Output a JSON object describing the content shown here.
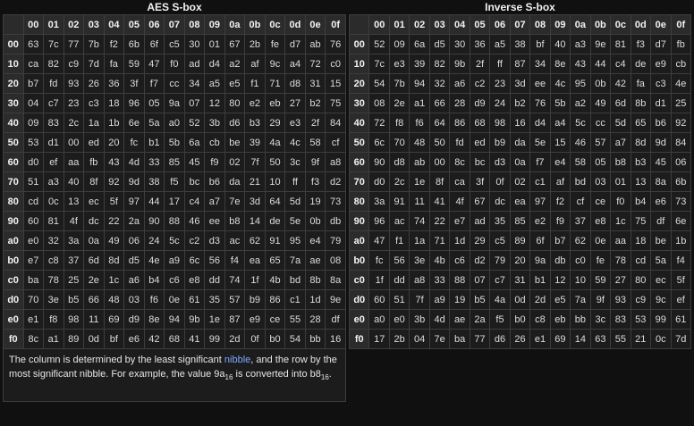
{
  "aes": {
    "caption": "AES S-box",
    "col_headers": [
      "00",
      "01",
      "02",
      "03",
      "04",
      "05",
      "06",
      "07",
      "08",
      "09",
      "0a",
      "0b",
      "0c",
      "0d",
      "0e",
      "0f"
    ],
    "rows": [
      {
        "h": "00",
        "c": [
          "63",
          "7c",
          "77",
          "7b",
          "f2",
          "6b",
          "6f",
          "c5",
          "30",
          "01",
          "67",
          "2b",
          "fe",
          "d7",
          "ab",
          "76"
        ]
      },
      {
        "h": "10",
        "c": [
          "ca",
          "82",
          "c9",
          "7d",
          "fa",
          "59",
          "47",
          "f0",
          "ad",
          "d4",
          "a2",
          "af",
          "9c",
          "a4",
          "72",
          "c0"
        ]
      },
      {
        "h": "20",
        "c": [
          "b7",
          "fd",
          "93",
          "26",
          "36",
          "3f",
          "f7",
          "cc",
          "34",
          "a5",
          "e5",
          "f1",
          "71",
          "d8",
          "31",
          "15"
        ]
      },
      {
        "h": "30",
        "c": [
          "04",
          "c7",
          "23",
          "c3",
          "18",
          "96",
          "05",
          "9a",
          "07",
          "12",
          "80",
          "e2",
          "eb",
          "27",
          "b2",
          "75"
        ]
      },
      {
        "h": "40",
        "c": [
          "09",
          "83",
          "2c",
          "1a",
          "1b",
          "6e",
          "5a",
          "a0",
          "52",
          "3b",
          "d6",
          "b3",
          "29",
          "e3",
          "2f",
          "84"
        ]
      },
      {
        "h": "50",
        "c": [
          "53",
          "d1",
          "00",
          "ed",
          "20",
          "fc",
          "b1",
          "5b",
          "6a",
          "cb",
          "be",
          "39",
          "4a",
          "4c",
          "58",
          "cf"
        ]
      },
      {
        "h": "60",
        "c": [
          "d0",
          "ef",
          "aa",
          "fb",
          "43",
          "4d",
          "33",
          "85",
          "45",
          "f9",
          "02",
          "7f",
          "50",
          "3c",
          "9f",
          "a8"
        ]
      },
      {
        "h": "70",
        "c": [
          "51",
          "a3",
          "40",
          "8f",
          "92",
          "9d",
          "38",
          "f5",
          "bc",
          "b6",
          "da",
          "21",
          "10",
          "ff",
          "f3",
          "d2"
        ]
      },
      {
        "h": "80",
        "c": [
          "cd",
          "0c",
          "13",
          "ec",
          "5f",
          "97",
          "44",
          "17",
          "c4",
          "a7",
          "7e",
          "3d",
          "64",
          "5d",
          "19",
          "73"
        ]
      },
      {
        "h": "90",
        "c": [
          "60",
          "81",
          "4f",
          "dc",
          "22",
          "2a",
          "90",
          "88",
          "46",
          "ee",
          "b8",
          "14",
          "de",
          "5e",
          "0b",
          "db"
        ]
      },
      {
        "h": "a0",
        "c": [
          "e0",
          "32",
          "3a",
          "0a",
          "49",
          "06",
          "24",
          "5c",
          "c2",
          "d3",
          "ac",
          "62",
          "91",
          "95",
          "e4",
          "79"
        ]
      },
      {
        "h": "b0",
        "c": [
          "e7",
          "c8",
          "37",
          "6d",
          "8d",
          "d5",
          "4e",
          "a9",
          "6c",
          "56",
          "f4",
          "ea",
          "65",
          "7a",
          "ae",
          "08"
        ]
      },
      {
        "h": "c0",
        "c": [
          "ba",
          "78",
          "25",
          "2e",
          "1c",
          "a6",
          "b4",
          "c6",
          "e8",
          "dd",
          "74",
          "1f",
          "4b",
          "bd",
          "8b",
          "8a"
        ]
      },
      {
        "h": "d0",
        "c": [
          "70",
          "3e",
          "b5",
          "66",
          "48",
          "03",
          "f6",
          "0e",
          "61",
          "35",
          "57",
          "b9",
          "86",
          "c1",
          "1d",
          "9e"
        ]
      },
      {
        "h": "e0",
        "c": [
          "e1",
          "f8",
          "98",
          "11",
          "69",
          "d9",
          "8e",
          "94",
          "9b",
          "1e",
          "87",
          "e9",
          "ce",
          "55",
          "28",
          "df"
        ]
      },
      {
        "h": "f0",
        "c": [
          "8c",
          "a1",
          "89",
          "0d",
          "bf",
          "e6",
          "42",
          "68",
          "41",
          "99",
          "2d",
          "0f",
          "b0",
          "54",
          "bb",
          "16"
        ]
      }
    ]
  },
  "inverse": {
    "caption": "Inverse S-box",
    "col_headers": [
      "00",
      "01",
      "02",
      "03",
      "04",
      "05",
      "06",
      "07",
      "08",
      "09",
      "0a",
      "0b",
      "0c",
      "0d",
      "0e",
      "0f"
    ],
    "rows": [
      {
        "h": "00",
        "c": [
          "52",
          "09",
          "6a",
          "d5",
          "30",
          "36",
          "a5",
          "38",
          "bf",
          "40",
          "a3",
          "9e",
          "81",
          "f3",
          "d7",
          "fb"
        ]
      },
      {
        "h": "10",
        "c": [
          "7c",
          "e3",
          "39",
          "82",
          "9b",
          "2f",
          "ff",
          "87",
          "34",
          "8e",
          "43",
          "44",
          "c4",
          "de",
          "e9",
          "cb"
        ]
      },
      {
        "h": "20",
        "c": [
          "54",
          "7b",
          "94",
          "32",
          "a6",
          "c2",
          "23",
          "3d",
          "ee",
          "4c",
          "95",
          "0b",
          "42",
          "fa",
          "c3",
          "4e"
        ]
      },
      {
        "h": "30",
        "c": [
          "08",
          "2e",
          "a1",
          "66",
          "28",
          "d9",
          "24",
          "b2",
          "76",
          "5b",
          "a2",
          "49",
          "6d",
          "8b",
          "d1",
          "25"
        ]
      },
      {
        "h": "40",
        "c": [
          "72",
          "f8",
          "f6",
          "64",
          "86",
          "68",
          "98",
          "16",
          "d4",
          "a4",
          "5c",
          "cc",
          "5d",
          "65",
          "b6",
          "92"
        ]
      },
      {
        "h": "50",
        "c": [
          "6c",
          "70",
          "48",
          "50",
          "fd",
          "ed",
          "b9",
          "da",
          "5e",
          "15",
          "46",
          "57",
          "a7",
          "8d",
          "9d",
          "84"
        ]
      },
      {
        "h": "60",
        "c": [
          "90",
          "d8",
          "ab",
          "00",
          "8c",
          "bc",
          "d3",
          "0a",
          "f7",
          "e4",
          "58",
          "05",
          "b8",
          "b3",
          "45",
          "06"
        ]
      },
      {
        "h": "70",
        "c": [
          "d0",
          "2c",
          "1e",
          "8f",
          "ca",
          "3f",
          "0f",
          "02",
          "c1",
          "af",
          "bd",
          "03",
          "01",
          "13",
          "8a",
          "6b"
        ]
      },
      {
        "h": "80",
        "c": [
          "3a",
          "91",
          "11",
          "41",
          "4f",
          "67",
          "dc",
          "ea",
          "97",
          "f2",
          "cf",
          "ce",
          "f0",
          "b4",
          "e6",
          "73"
        ]
      },
      {
        "h": "90",
        "c": [
          "96",
          "ac",
          "74",
          "22",
          "e7",
          "ad",
          "35",
          "85",
          "e2",
          "f9",
          "37",
          "e8",
          "1c",
          "75",
          "df",
          "6e"
        ]
      },
      {
        "h": "a0",
        "c": [
          "47",
          "f1",
          "1a",
          "71",
          "1d",
          "29",
          "c5",
          "89",
          "6f",
          "b7",
          "62",
          "0e",
          "aa",
          "18",
          "be",
          "1b"
        ]
      },
      {
        "h": "b0",
        "c": [
          "fc",
          "56",
          "3e",
          "4b",
          "c6",
          "d2",
          "79",
          "20",
          "9a",
          "db",
          "c0",
          "fe",
          "78",
          "cd",
          "5a",
          "f4"
        ]
      },
      {
        "h": "c0",
        "c": [
          "1f",
          "dd",
          "a8",
          "33",
          "88",
          "07",
          "c7",
          "31",
          "b1",
          "12",
          "10",
          "59",
          "27",
          "80",
          "ec",
          "5f"
        ]
      },
      {
        "h": "d0",
        "c": [
          "60",
          "51",
          "7f",
          "a9",
          "19",
          "b5",
          "4a",
          "0d",
          "2d",
          "e5",
          "7a",
          "9f",
          "93",
          "c9",
          "9c",
          "ef"
        ]
      },
      {
        "h": "e0",
        "c": [
          "a0",
          "e0",
          "3b",
          "4d",
          "ae",
          "2a",
          "f5",
          "b0",
          "c8",
          "eb",
          "bb",
          "3c",
          "83",
          "53",
          "99",
          "61"
        ]
      },
      {
        "h": "f0",
        "c": [
          "17",
          "2b",
          "04",
          "7e",
          "ba",
          "77",
          "d6",
          "26",
          "e1",
          "69",
          "14",
          "63",
          "55",
          "21",
          "0c",
          "7d"
        ]
      }
    ]
  },
  "note": {
    "before_link": "The column is determined by the least significant ",
    "link_text": "nibble",
    "after_link": ", and the row by the most significant nibble. For example, the value 9a",
    "sub1": "16",
    "middle": " is converted into b8",
    "sub2": "16",
    "end": "."
  },
  "colors": {
    "link": "#7fa7ff",
    "header_bg": "#2b2b2b",
    "cell_bg": "#1c1c1c"
  }
}
